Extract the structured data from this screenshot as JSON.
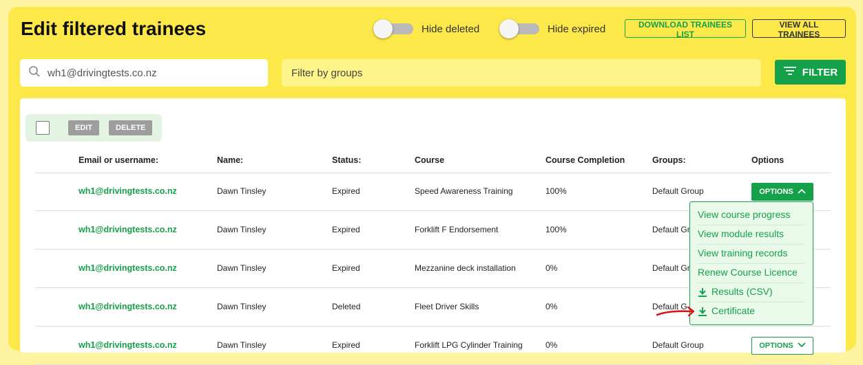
{
  "header": {
    "title": "Edit filtered trainees",
    "hide_deleted_label": "Hide deleted",
    "hide_expired_label": "Hide expired",
    "download_label": "DOWNLOAD TRAINEES LIST",
    "view_all_label": "VIEW ALL TRAINEES"
  },
  "search": {
    "value": "wh1@drivingtests.co.nz",
    "groups_placeholder": "Filter by groups",
    "filter_label": "FILTER"
  },
  "bulk": {
    "edit_label": "EDIT",
    "delete_label": "DELETE"
  },
  "table": {
    "headers": {
      "email": "Email or username:",
      "name": "Name:",
      "status": "Status:",
      "course": "Course",
      "completion": "Course Completion",
      "groups": "Groups:",
      "options": "Options"
    },
    "rows": [
      {
        "email": "wh1@drivingtests.co.nz",
        "name": "Dawn Tinsley",
        "status": "Expired",
        "course": "Speed Awareness Training",
        "completion": "100%",
        "group": "Default Group",
        "options": "OPTIONS"
      },
      {
        "email": "wh1@drivingtests.co.nz",
        "name": "Dawn Tinsley",
        "status": "Expired",
        "course": "Forklift F Endorsement",
        "completion": "100%",
        "group": "Default Gr"
      },
      {
        "email": "wh1@drivingtests.co.nz",
        "name": "Dawn Tinsley",
        "status": "Expired",
        "course": "Mezzanine deck installation",
        "completion": "0%",
        "group": "Default Gr"
      },
      {
        "email": "wh1@drivingtests.co.nz",
        "name": "Dawn Tinsley",
        "status": "Deleted",
        "course": "Fleet Driver Skills",
        "completion": "0%",
        "group": "Default G"
      },
      {
        "email": "wh1@drivingtests.co.nz",
        "name": "Dawn Tinsley",
        "status": "Expired",
        "course": "Forklift LPG Cylinder Training",
        "completion": "0%",
        "group": "Default Group",
        "options": "OPTIONS"
      }
    ]
  },
  "dropdown": {
    "items": [
      "View course progress",
      "View module results",
      "View training records",
      "Renew Course Licence",
      "Results (CSV)",
      "Certificate"
    ]
  },
  "colors": {
    "accent": "#15a04a",
    "background": "#fde84a",
    "annotation": "#d9141c"
  },
  "icons": [
    "search-icon",
    "filter-lines-icon",
    "chevron-up-icon",
    "chevron-down-icon",
    "download-icon"
  ]
}
